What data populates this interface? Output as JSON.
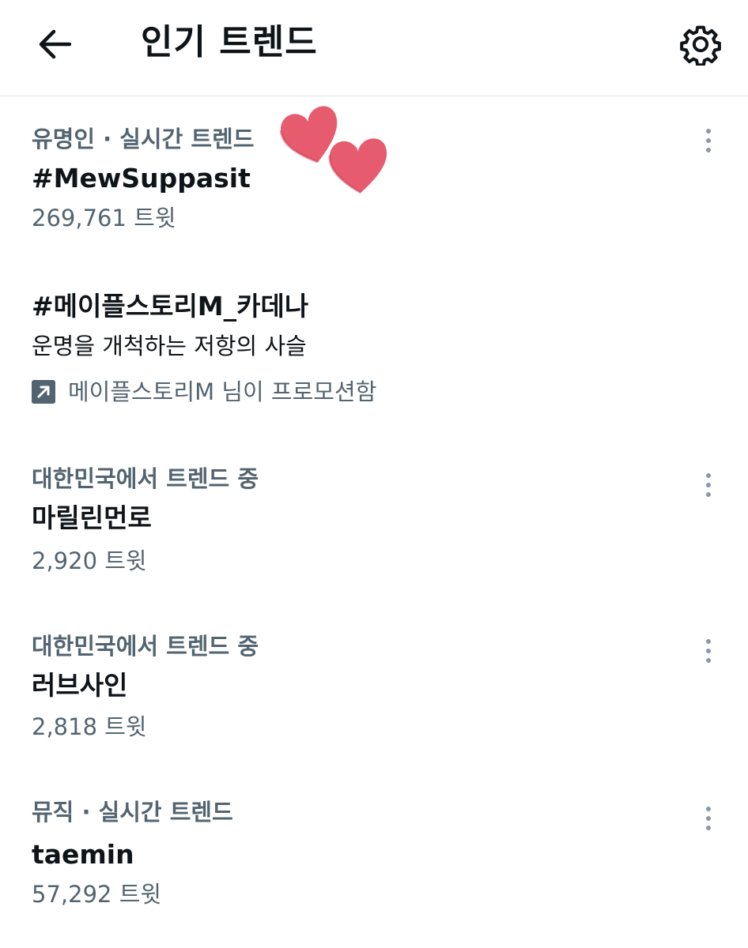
{
  "header": {
    "title": "인기 트렌드",
    "back_icon": "arrow-left-icon",
    "settings_icon": "gear-icon"
  },
  "trends": [
    {
      "context": "유명인 · 실시간 트렌드",
      "name": "#MewSuppasit",
      "tweets": "269,761 트윗"
    },
    {
      "name": "#메이플스토리M_카데나",
      "description": "운명을 개척하는 저항의 사슬",
      "promoted": "메이플스토리M 님이 프로모션함"
    },
    {
      "context": "대한민국에서 트렌드 중",
      "name": "마릴린먼로",
      "tweets": "2,920 트윗"
    },
    {
      "context": "대한민국에서 트렌드 중",
      "name": "러브사인",
      "tweets": "2,818 트윗"
    },
    {
      "context": "뮤직 · 실시간 트렌드",
      "name": "taemin",
      "tweets": "57,292 트윗"
    }
  ],
  "icons": {
    "more": "more-vertical-icon",
    "promoted": "promoted-arrow-icon",
    "sticker": "heart-icon"
  },
  "colors": {
    "text_primary": "#0f1419",
    "text_secondary": "#536471",
    "divider": "#dfe3e6",
    "heart": "#e75b6e"
  }
}
